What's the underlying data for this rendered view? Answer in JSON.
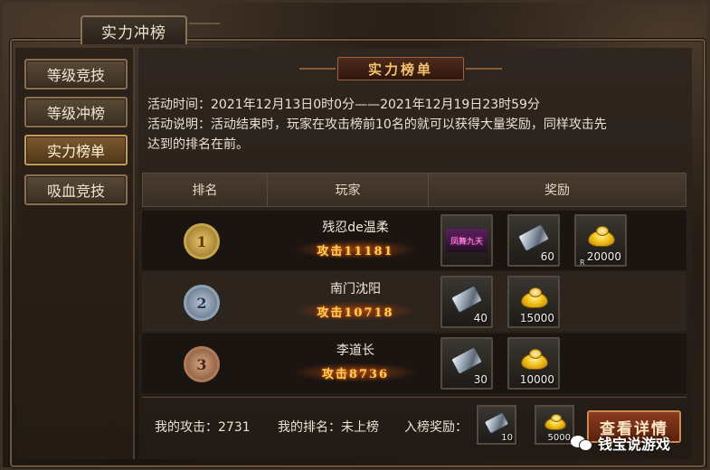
{
  "window": {
    "title": "实力冲榜"
  },
  "sidebar": {
    "items": [
      {
        "label": "等级竞技",
        "active": false
      },
      {
        "label": "等级冲榜",
        "active": false
      },
      {
        "label": "实力榜单",
        "active": true
      },
      {
        "label": "吸血竞技",
        "active": false
      }
    ]
  },
  "main": {
    "banner": "实力榜单",
    "activity_time": "活动时间：2021年12月13日0时0分——2021年12月19日23时59分",
    "activity_desc_line1": "活动说明：活动结束时，玩家在攻击榜前10名的就可以获得大量奖励，同样攻击先",
    "activity_desc_line2": "达到的排名在前。",
    "columns": {
      "rank": "排名",
      "player": "玩家",
      "reward": "奖励"
    },
    "rows": [
      {
        "rank": "1",
        "medal": "gold",
        "player": "残忍de温柔",
        "attack": "攻击11181",
        "rewards": [
          {
            "icon": "title-badge-icon",
            "label": "凤舞九天",
            "qty": ""
          },
          {
            "icon": "silver-stone-icon",
            "qty": "60"
          },
          {
            "icon": "gold-ingot-icon",
            "qty": "20000",
            "corner": "R"
          }
        ]
      },
      {
        "rank": "2",
        "medal": "silver",
        "player": "南门沈阳",
        "attack": "攻击10718",
        "rewards": [
          {
            "icon": "silver-stone-icon",
            "qty": "40"
          },
          {
            "icon": "gold-ingot-icon",
            "qty": "15000"
          }
        ]
      },
      {
        "rank": "3",
        "medal": "bronze",
        "player": "李道长",
        "attack": "攻击8736",
        "rewards": [
          {
            "icon": "silver-stone-icon",
            "qty": "30"
          },
          {
            "icon": "gold-ingot-icon",
            "qty": "10000"
          }
        ]
      }
    ]
  },
  "footer": {
    "my_attack": "我的攻击：2731",
    "my_rank": "我的排名：未上榜",
    "entry_reward_label": "入榜奖励：",
    "entry_rewards": [
      {
        "icon": "silver-stone-icon",
        "qty": "10"
      },
      {
        "icon": "gold-ingot-icon",
        "qty": "5000"
      }
    ],
    "detail_button": "查看详情"
  },
  "watermark": "钱宝说游戏",
  "colors": {
    "accent_gold": "#f3c26b",
    "attack_text": "#ffcf5a",
    "panel_bg": "#2f2620"
  }
}
